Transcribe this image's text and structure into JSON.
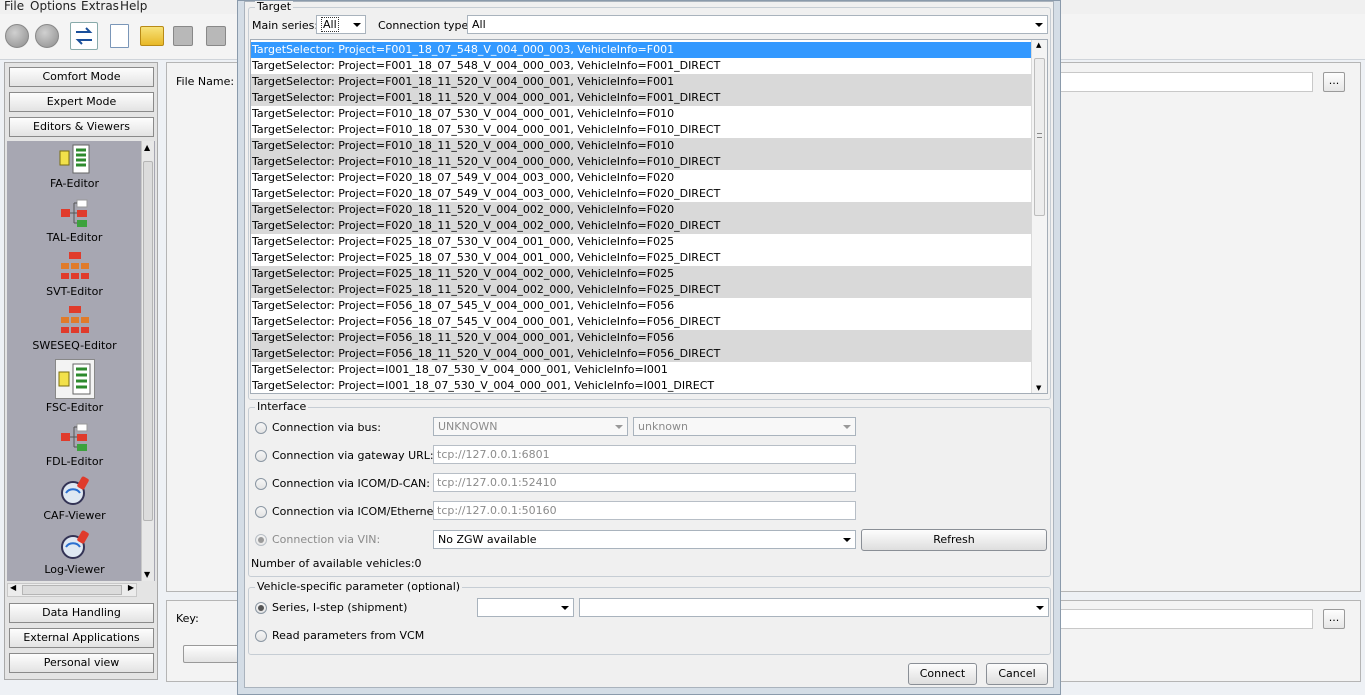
{
  "menu": [
    "File",
    "Options",
    "Extras",
    "Help"
  ],
  "left_panel": {
    "mode_buttons": [
      "Comfort Mode",
      "Expert Mode",
      "Editors & Viewers"
    ],
    "editors": [
      {
        "label": "FA-Editor",
        "icon": "fa-editor-icon"
      },
      {
        "label": "TAL-Editor",
        "icon": "tal-editor-icon"
      },
      {
        "label": "SVT-Editor",
        "icon": "svt-editor-icon"
      },
      {
        "label": "SWESEQ-Editor",
        "icon": "sweseq-editor-icon"
      },
      {
        "label": "FSC-Editor",
        "icon": "fsc-editor-icon"
      },
      {
        "label": "FDL-Editor",
        "icon": "fdl-editor-icon"
      },
      {
        "label": "CAF-Viewer",
        "icon": "caf-viewer-icon"
      },
      {
        "label": "Log-Viewer",
        "icon": "log-viewer-icon"
      }
    ],
    "bottom_buttons": [
      "Data Handling",
      "External Applications",
      "Personal view"
    ]
  },
  "main": {
    "file_name_label": "File Name:",
    "key_label": "Key:",
    "browse_label": "..."
  },
  "dialog": {
    "target": {
      "title": "Target",
      "main_series_label": "Main series:",
      "main_series_value": "All",
      "connection_type_label": "Connection type:",
      "connection_type_value": "All",
      "items": [
        "TargetSelector: Project=F001_18_07_548_V_004_000_003, VehicleInfo=F001",
        "TargetSelector: Project=F001_18_07_548_V_004_000_003, VehicleInfo=F001_DIRECT",
        "TargetSelector: Project=F001_18_11_520_V_004_000_001, VehicleInfo=F001",
        "TargetSelector: Project=F001_18_11_520_V_004_000_001, VehicleInfo=F001_DIRECT",
        "TargetSelector: Project=F010_18_07_530_V_004_000_001, VehicleInfo=F010",
        "TargetSelector: Project=F010_18_07_530_V_004_000_001, VehicleInfo=F010_DIRECT",
        "TargetSelector: Project=F010_18_11_520_V_004_000_000, VehicleInfo=F010",
        "TargetSelector: Project=F010_18_11_520_V_004_000_000, VehicleInfo=F010_DIRECT",
        "TargetSelector: Project=F020_18_07_549_V_004_003_000, VehicleInfo=F020",
        "TargetSelector: Project=F020_18_07_549_V_004_003_000, VehicleInfo=F020_DIRECT",
        "TargetSelector: Project=F020_18_11_520_V_004_002_000, VehicleInfo=F020",
        "TargetSelector: Project=F020_18_11_520_V_004_002_000, VehicleInfo=F020_DIRECT",
        "TargetSelector: Project=F025_18_07_530_V_004_001_000, VehicleInfo=F025",
        "TargetSelector: Project=F025_18_07_530_V_004_001_000, VehicleInfo=F025_DIRECT",
        "TargetSelector: Project=F025_18_11_520_V_004_002_000, VehicleInfo=F025",
        "TargetSelector: Project=F025_18_11_520_V_004_002_000, VehicleInfo=F025_DIRECT",
        "TargetSelector: Project=F056_18_07_545_V_004_000_001, VehicleInfo=F056",
        "TargetSelector: Project=F056_18_07_545_V_004_000_001, VehicleInfo=F056_DIRECT",
        "TargetSelector: Project=F056_18_11_520_V_004_000_001, VehicleInfo=F056",
        "TargetSelector: Project=F056_18_11_520_V_004_000_001, VehicleInfo=F056_DIRECT",
        "TargetSelector: Project=I001_18_07_530_V_004_000_001, VehicleInfo=I001",
        "TargetSelector: Project=I001_18_07_530_V_004_000_001, VehicleInfo=I001_DIRECT"
      ],
      "selected_index": 0
    },
    "interface": {
      "title": "Interface",
      "bus_label": "Connection via bus:",
      "bus_value_1": "UNKNOWN",
      "bus_value_2": "unknown",
      "gateway_label": "Connection via gateway URL:",
      "gateway_value": "tcp://127.0.0.1:6801",
      "icom_dcan_label": "Connection via ICOM/D-CAN:",
      "icom_dcan_value": "tcp://127.0.0.1:52410",
      "icom_eth_label": "Connection via ICOM/Ethernet:",
      "icom_eth_value": "tcp://127.0.0.1:50160",
      "vin_label": "Connection via VIN:",
      "vin_value": "No ZGW available",
      "refresh_label": "Refresh",
      "available_vehicles": "Number of available vehicles:0"
    },
    "vehicle": {
      "title": "Vehicle-specific parameter (optional)",
      "series_label": "Series, I-step (shipment)",
      "vcm_label": "Read parameters from VCM"
    },
    "connect_label": "Connect",
    "cancel_label": "Cancel"
  }
}
